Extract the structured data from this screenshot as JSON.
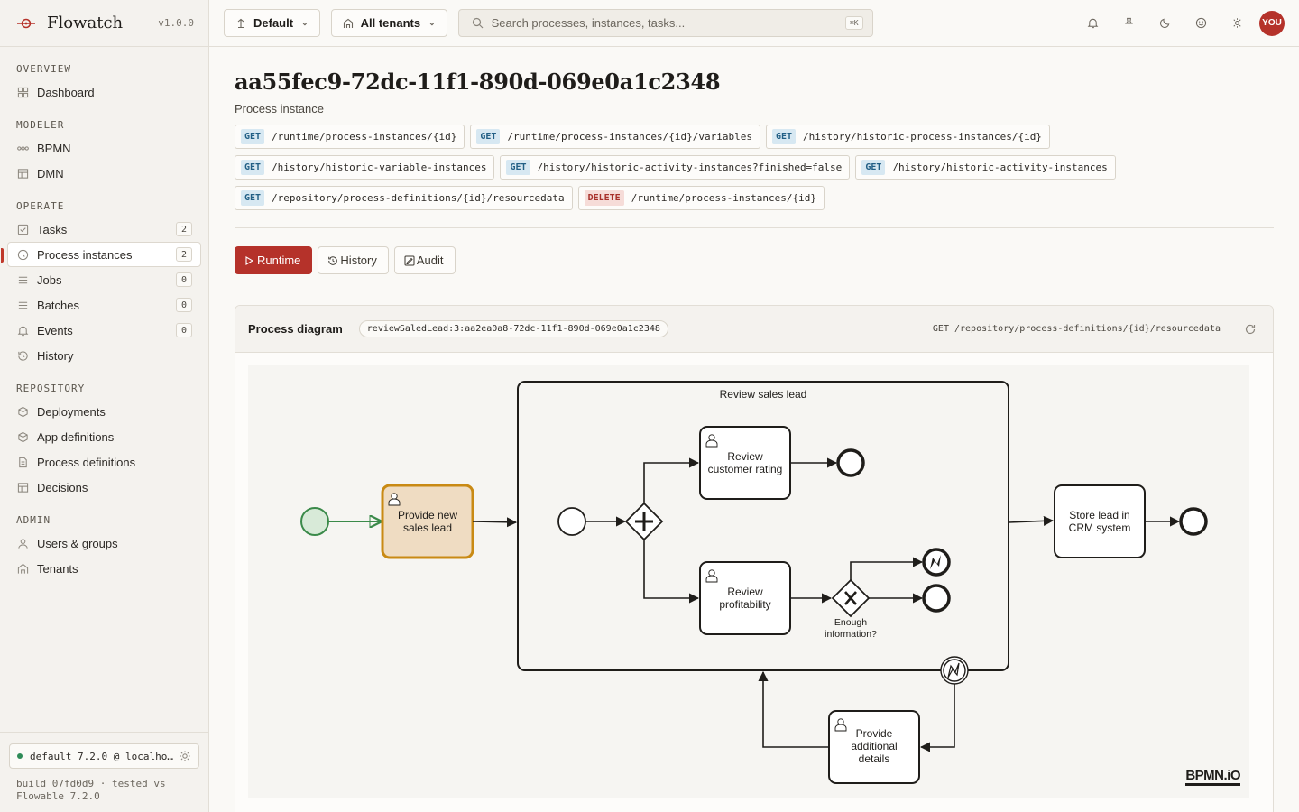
{
  "brand": {
    "name": "Flowatch",
    "version": "v1.0.0"
  },
  "nav": {
    "sections": [
      {
        "title": "OVERVIEW",
        "items": [
          {
            "label": "Dashboard",
            "icon": "dashboard-icon"
          }
        ]
      },
      {
        "title": "MODELER",
        "items": [
          {
            "label": "BPMN",
            "icon": "bpmn-icon"
          },
          {
            "label": "DMN",
            "icon": "table-icon"
          }
        ]
      },
      {
        "title": "OPERATE",
        "items": [
          {
            "label": "Tasks",
            "icon": "task-icon",
            "count": "2"
          },
          {
            "label": "Process instances",
            "icon": "clock-icon",
            "count": "2",
            "active": true
          },
          {
            "label": "Jobs",
            "icon": "list-icon",
            "count": "0"
          },
          {
            "label": "Batches",
            "icon": "list-icon",
            "count": "0"
          },
          {
            "label": "Events",
            "icon": "bell-icon",
            "count": "0"
          },
          {
            "label": "History",
            "icon": "history-icon"
          }
        ]
      },
      {
        "title": "REPOSITORY",
        "items": [
          {
            "label": "Deployments",
            "icon": "box-icon"
          },
          {
            "label": "App definitions",
            "icon": "box-icon"
          },
          {
            "label": "Process definitions",
            "icon": "document-icon"
          },
          {
            "label": "Decisions",
            "icon": "table-icon"
          }
        ]
      },
      {
        "title": "ADMIN",
        "items": [
          {
            "label": "Users & groups",
            "icon": "user-icon"
          },
          {
            "label": "Tenants",
            "icon": "building-icon"
          }
        ]
      }
    ]
  },
  "footer": {
    "env": "default 7.2.0 @ localhost",
    "build_line1": "build 07fd0d9 · tested vs",
    "build_line2": "Flowable 7.2.0"
  },
  "topbar": {
    "engine_select": "Default",
    "tenant_select": "All tenants",
    "search_placeholder": "Search processes, instances, tasks...",
    "search_shortcut": "⌘K",
    "avatar": "YOU"
  },
  "page": {
    "title": "aa55fec9-72dc-11f1-890d-069e0a1c2348",
    "subtitle": "Process instance",
    "endpoints": [
      {
        "method": "GET",
        "path": "/runtime/process-instances/{id}"
      },
      {
        "method": "GET",
        "path": "/runtime/process-instances/{id}/variables"
      },
      {
        "method": "GET",
        "path": "/history/historic-process-instances/{id}"
      },
      {
        "method": "GET",
        "path": "/history/historic-variable-instances"
      },
      {
        "method": "GET",
        "path": "/history/historic-activity-instances?finished=false"
      },
      {
        "method": "GET",
        "path": "/history/historic-activity-instances"
      },
      {
        "method": "GET",
        "path": "/repository/process-definitions/{id}/resourcedata"
      },
      {
        "method": "DELETE",
        "path": "/runtime/process-instances/{id}"
      }
    ],
    "tabs": [
      {
        "label": "Runtime",
        "icon": "play-icon",
        "active": true
      },
      {
        "label": "History",
        "icon": "history-icon"
      },
      {
        "label": "Audit",
        "icon": "audit-icon"
      }
    ]
  },
  "diagram_panel": {
    "title": "Process diagram",
    "definition_id": "reviewSaledLead:3:aa2ea0a8-72dc-11f1-890d-069e0a1c2348",
    "endpoint": "GET /repository/process-definitions/{id}/resourcedata",
    "watermark": "BPMN.iO"
  },
  "diagram": {
    "subprocess_label": "Review sales lead",
    "provide_lead": [
      "Provide new",
      "sales lead"
    ],
    "review_rating": [
      "Review",
      "customer rating"
    ],
    "review_profit": [
      "Review",
      "profitability"
    ],
    "store_lead": [
      "Store lead in",
      "CRM system"
    ],
    "additional": [
      "Provide",
      "additional",
      "details"
    ],
    "gateway_label": [
      "Enough",
      "information?"
    ],
    "colors": {
      "active_fill": "#efdcc2",
      "active_stroke": "#c98a14",
      "start_stroke": "#3b8a4a",
      "start_fill": "#d8ead8",
      "accent": "#b5322a"
    }
  }
}
